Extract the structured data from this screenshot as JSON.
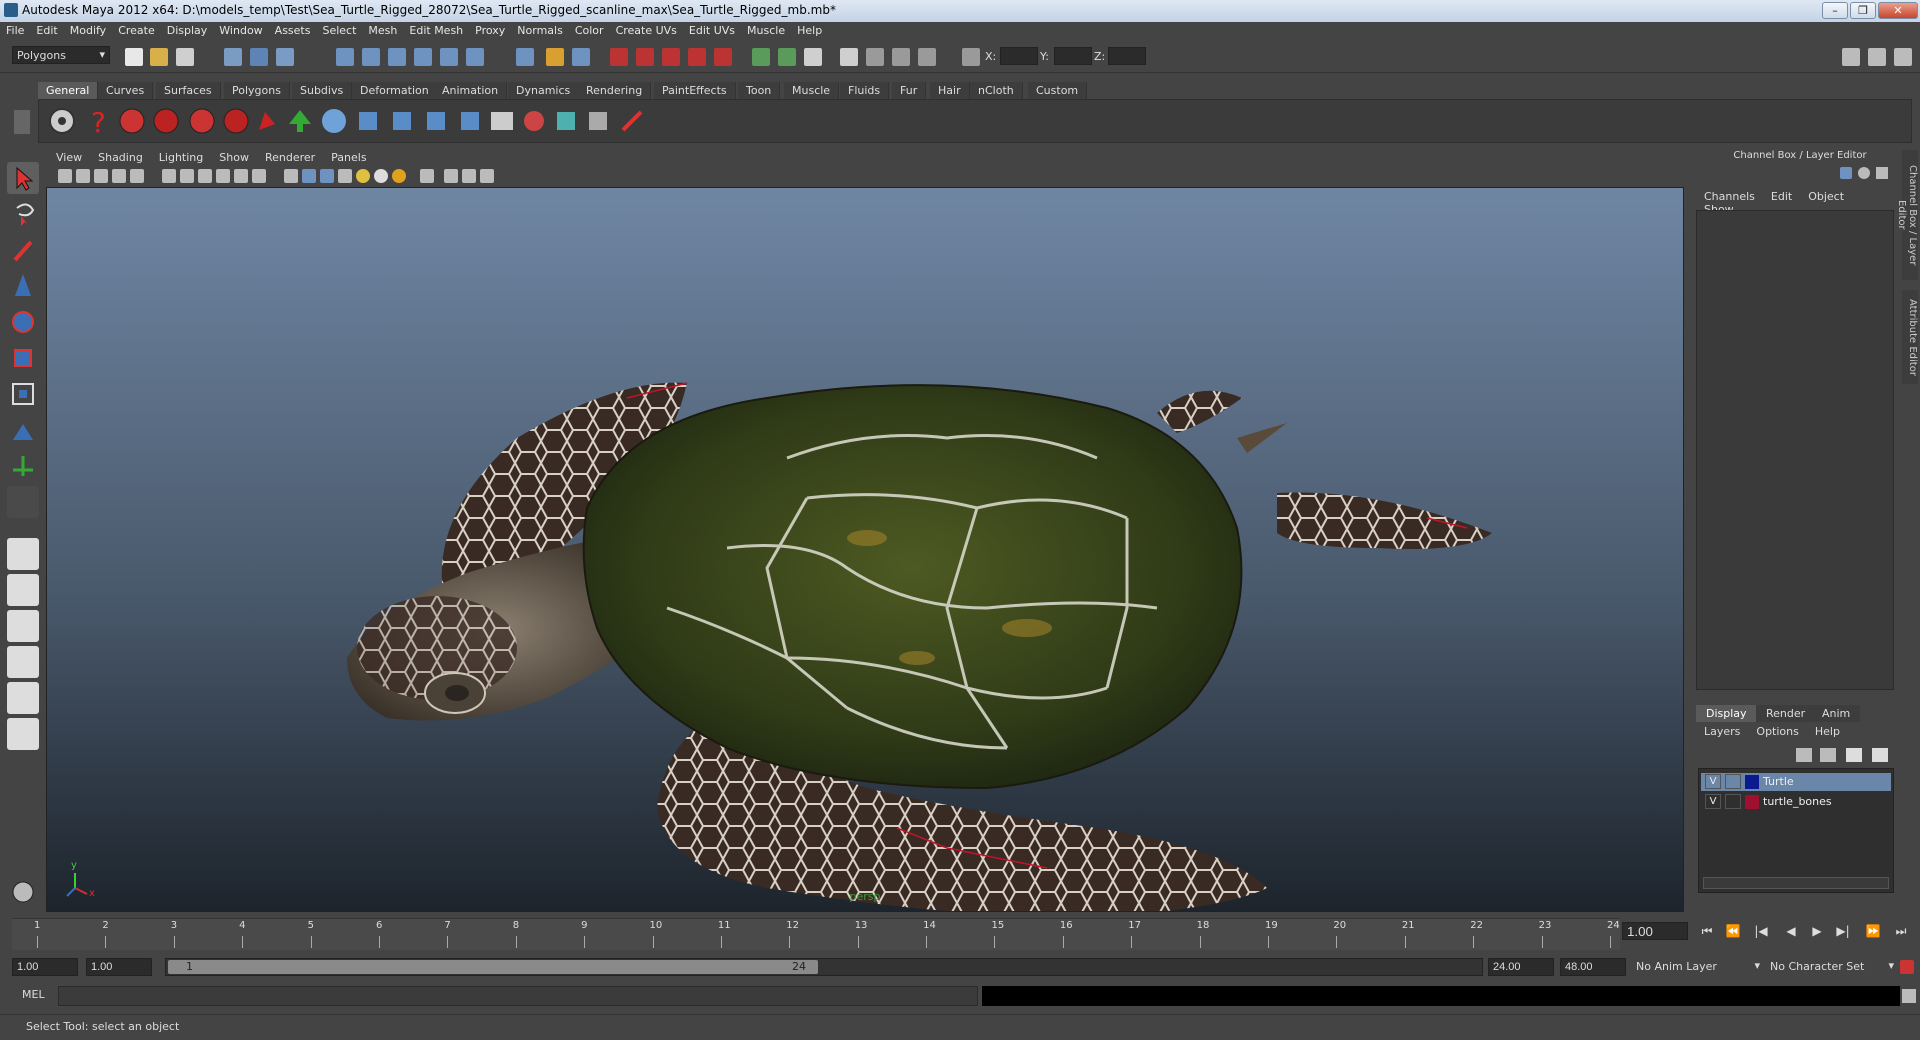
{
  "window": {
    "title": "Autodesk Maya 2012 x64: D:\\models_temp\\Test\\Sea_Turtle_Rigged_28072\\Sea_Turtle_Rigged_scanline_max\\Sea_Turtle_Rigged_mb.mb*",
    "minimize": "–",
    "restore": "❐",
    "close": "✕"
  },
  "menubar": [
    "File",
    "Edit",
    "Modify",
    "Create",
    "Display",
    "Window",
    "Assets",
    "Select",
    "Mesh",
    "Edit Mesh",
    "Proxy",
    "Normals",
    "Color",
    "Create UVs",
    "Edit UVs",
    "Muscle",
    "Help"
  ],
  "status_line": {
    "mode": "Polygons",
    "x_label": "X:",
    "y_label": "Y:",
    "z_label": "Z:"
  },
  "shelf": {
    "tabs": [
      "General",
      "Curves",
      "Surfaces",
      "Polygons",
      "Subdivs",
      "Deformation",
      "Animation",
      "Dynamics",
      "Rendering",
      "PaintEffects",
      "Toon",
      "Muscle",
      "Fluids",
      "Fur",
      "Hair",
      "nCloth",
      "Custom"
    ],
    "active_tab": "General"
  },
  "viewport": {
    "menu": [
      "View",
      "Shading",
      "Lighting",
      "Show",
      "Renderer",
      "Panels"
    ],
    "camera_label": "persp",
    "axis_x": "x",
    "axis_y": "y"
  },
  "channel_box": {
    "title": "Channel Box / Layer Editor",
    "menu": [
      "Channels",
      "Edit",
      "Object",
      "Show"
    ]
  },
  "layer_editor": {
    "tabs": [
      "Display",
      "Render",
      "Anim"
    ],
    "active_tab": "Display",
    "menu": [
      "Layers",
      "Options",
      "Help"
    ],
    "layers": [
      {
        "visible": "V",
        "name": "Turtle",
        "color": "#0b1a8f",
        "selected": true
      },
      {
        "visible": "V",
        "name": "turtle_bones",
        "color": "#a01030",
        "selected": false
      }
    ]
  },
  "side_tabs": [
    "Channel Box / Layer Editor",
    "Attribute Editor"
  ],
  "time_slider": {
    "ticks": [
      "1",
      "2",
      "3",
      "4",
      "5",
      "6",
      "7",
      "8",
      "9",
      "10",
      "11",
      "12",
      "13",
      "14",
      "15",
      "16",
      "17",
      "18",
      "19",
      "20",
      "21",
      "22",
      "23",
      "24"
    ],
    "current_frame": "1.00"
  },
  "range_slider": {
    "start_time": "1.00",
    "playback_start": "1.00",
    "range_start_label": "1",
    "range_end_label": "24",
    "playback_end": "24.00",
    "end_time": "48.00",
    "anim_layer": "No Anim Layer",
    "character_set": "No Character Set"
  },
  "command_line": {
    "label": "MEL"
  },
  "help_line": {
    "text": "Select Tool: select an object"
  },
  "colors": {
    "ui_bg": "#444444",
    "selection": "#6a86a9",
    "viewport_top": "#6f86a3",
    "viewport_bottom": "#1d242c"
  }
}
